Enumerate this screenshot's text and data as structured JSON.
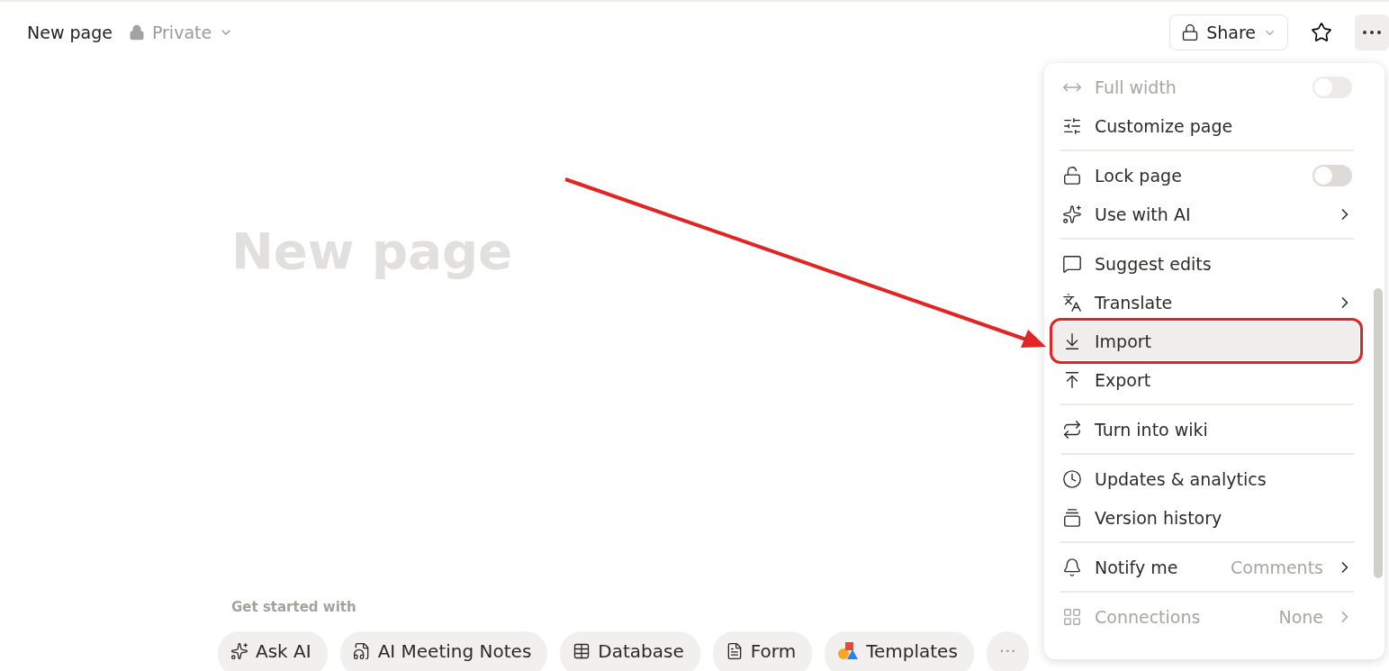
{
  "topbar": {
    "breadcrumb": "New page",
    "privacy": "Private",
    "share": "Share",
    "favorite": false,
    "more_open": true
  },
  "page": {
    "title_placeholder": "New page"
  },
  "get_started": {
    "heading": "Get started with",
    "chips": [
      {
        "label": "Ask AI"
      },
      {
        "label": "AI Meeting Notes"
      },
      {
        "label": "Database"
      },
      {
        "label": "Form"
      },
      {
        "label": "Templates"
      },
      {
        "label": "···",
        "kind": "more"
      }
    ]
  },
  "menu": {
    "groups": [
      [
        {
          "label": "Full width",
          "kind": "toggle",
          "on": false,
          "disabled": true
        },
        {
          "label": "Customize page",
          "kind": "plain",
          "disabled": false
        }
      ],
      [
        {
          "label": "Lock page",
          "kind": "toggle",
          "on": false,
          "disabled": false
        },
        {
          "label": "Use with AI",
          "kind": "submenu",
          "disabled": false
        }
      ],
      [
        {
          "label": "Suggest edits",
          "kind": "plain",
          "disabled": false
        },
        {
          "label": "Translate",
          "kind": "submenu",
          "disabled": false
        },
        {
          "label": "Import",
          "kind": "plain",
          "disabled": false,
          "selected": true,
          "annotated": true
        },
        {
          "label": "Export",
          "kind": "plain",
          "disabled": false
        }
      ],
      [
        {
          "label": "Turn into wiki",
          "kind": "plain",
          "disabled": false
        }
      ],
      [
        {
          "label": "Updates & analytics",
          "kind": "plain",
          "disabled": false
        },
        {
          "label": "Version history",
          "kind": "plain",
          "disabled": false
        }
      ],
      [
        {
          "label": "Notify me",
          "kind": "submenu",
          "value": "Comments",
          "disabled": false
        }
      ],
      [
        {
          "label": "Connections",
          "kind": "submenu",
          "value": "None",
          "disabled": true
        }
      ]
    ]
  },
  "annotation": {
    "arrow": true
  }
}
